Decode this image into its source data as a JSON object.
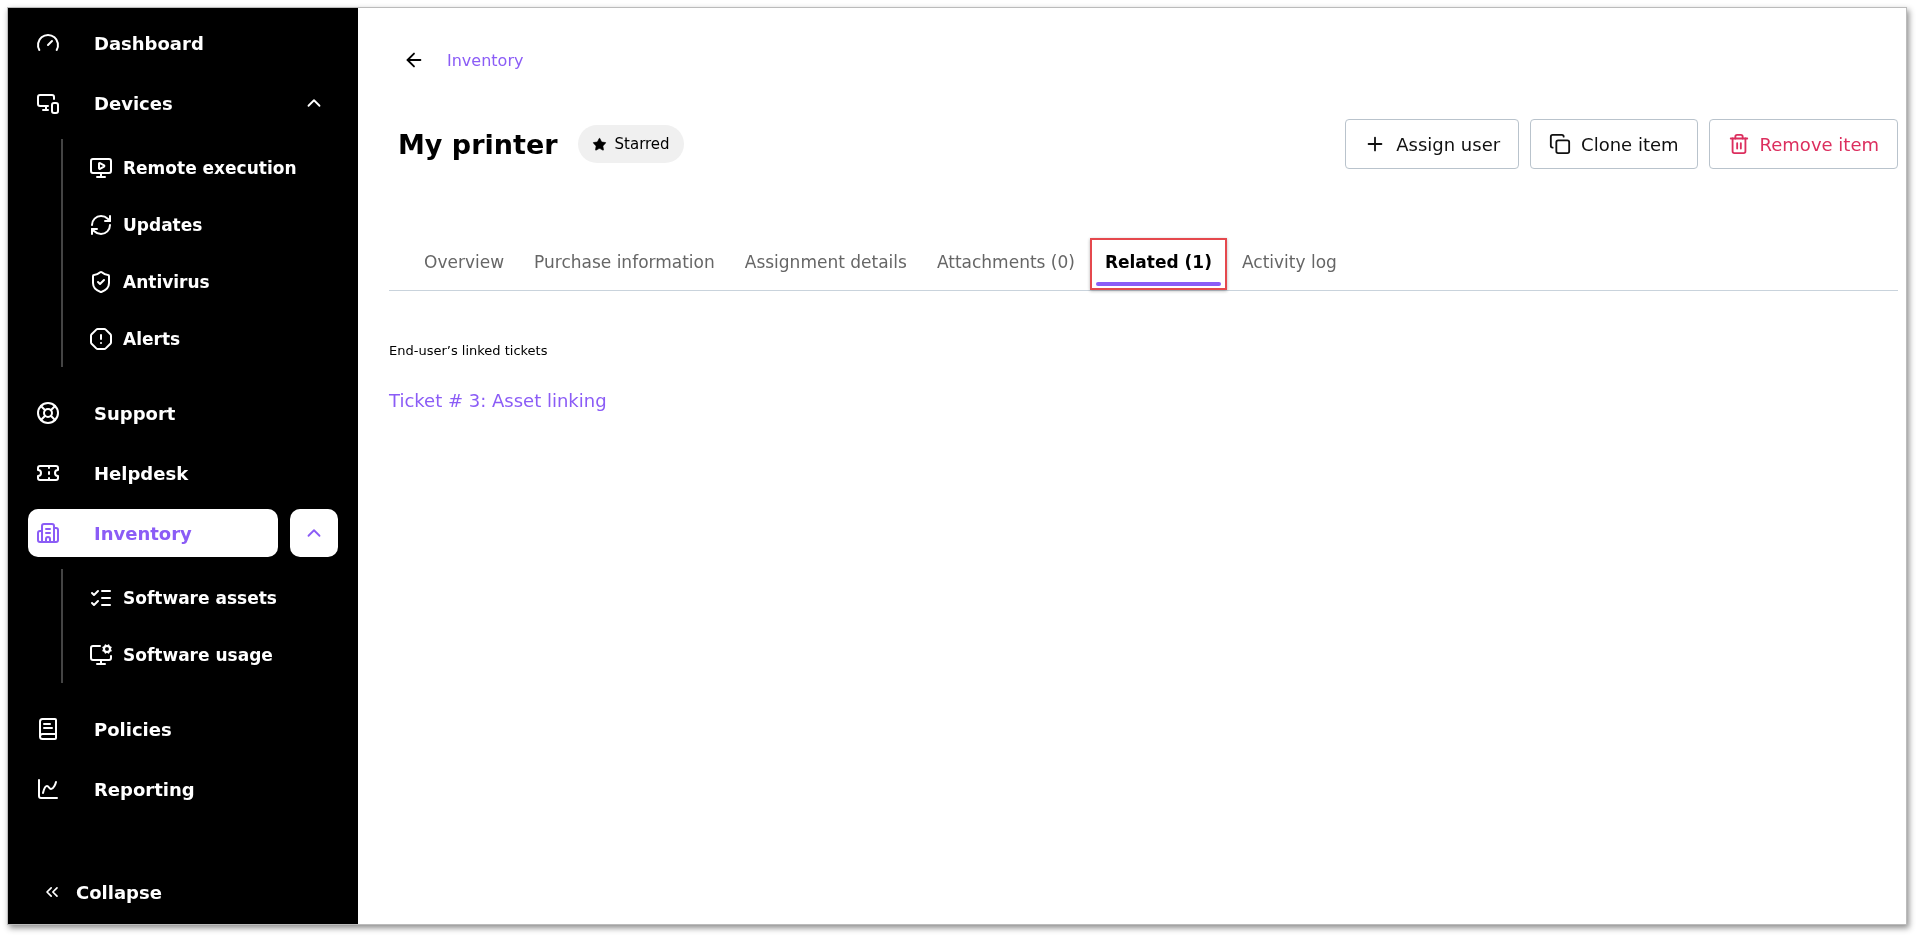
{
  "sidebar": {
    "items": [
      {
        "label": "Dashboard",
        "selected": false
      },
      {
        "label": "Devices",
        "selected": false,
        "expanded": true,
        "children": [
          {
            "label": "Remote execution",
            "selected": false
          },
          {
            "label": "Updates",
            "selected": false
          },
          {
            "label": "Antivirus",
            "selected": false
          },
          {
            "label": "Alerts",
            "selected": false
          }
        ]
      },
      {
        "label": "Support",
        "selected": false
      },
      {
        "label": "Helpdesk",
        "selected": false
      },
      {
        "label": "Inventory",
        "selected": true,
        "expanded": true,
        "children": [
          {
            "label": "Software assets",
            "selected": false
          },
          {
            "label": "Software usage",
            "selected": false
          }
        ]
      },
      {
        "label": "Policies",
        "selected": false
      },
      {
        "label": "Reporting",
        "selected": false
      }
    ],
    "collapse": "Collapse"
  },
  "breadcrumb": "Inventory",
  "title": "My printer",
  "starred": {
    "label": "Starred",
    "on": true
  },
  "actions": [
    {
      "label": "Assign user",
      "kind": "add"
    },
    {
      "label": "Clone item",
      "kind": "clone"
    },
    {
      "label": "Remove item",
      "kind": "remove"
    }
  ],
  "tabs": [
    {
      "label": "Overview",
      "selected": false
    },
    {
      "label": "Purchase information",
      "selected": false
    },
    {
      "label": "Assignment details",
      "selected": false
    },
    {
      "label": "Attachments (0)",
      "selected": false
    },
    {
      "label": "Related (1)",
      "selected": true
    },
    {
      "label": "Activity log",
      "selected": false
    }
  ],
  "section": {
    "heading": "End-user’s linked tickets",
    "links": [
      "Ticket # 3: Asset linking"
    ]
  }
}
